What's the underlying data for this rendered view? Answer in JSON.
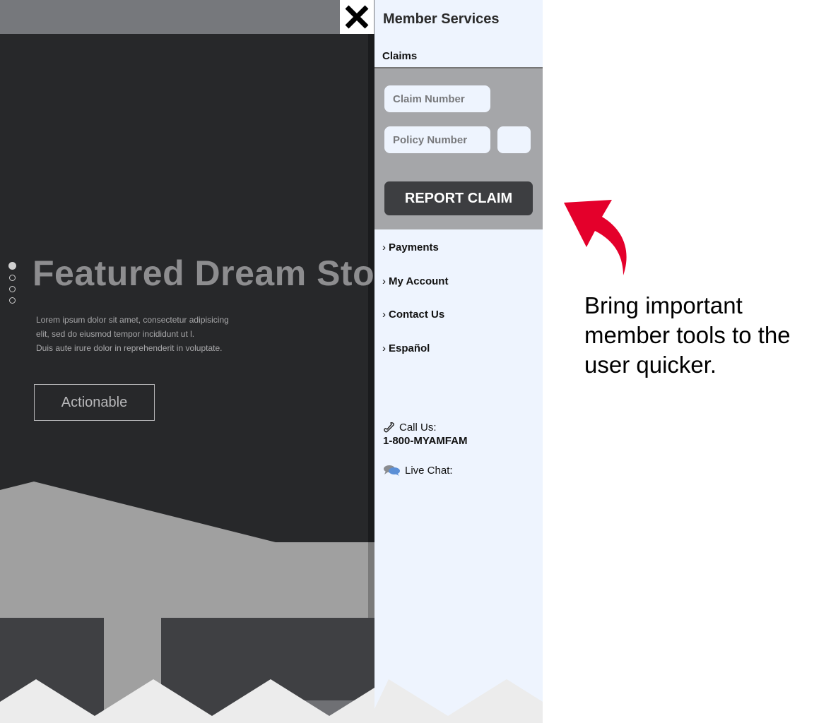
{
  "hero": {
    "title": "Featured Dream Story",
    "body_lines": [
      "Lorem ipsum dolor sit amet, consectetur adipisicing",
      "elit, sed do eiusmod tempor incididunt ut l.",
      "Duis aute irure dolor in reprehenderit in voluptate."
    ],
    "cta_label": "Actionable",
    "slide_count": 4,
    "active_slide": 1
  },
  "panel": {
    "title": "Member Services",
    "tab": "Claims",
    "claim_number_placeholder": "Claim Number",
    "policy_number_placeholder": "Policy Number",
    "report_button": "REPORT CLAIM",
    "nav": [
      {
        "chevron": "›",
        "label": "Payments"
      },
      {
        "chevron": "›",
        "label": "My Account"
      },
      {
        "chevron": "›",
        "label": "Contact Us"
      },
      {
        "chevron": "›",
        "label": "Español"
      }
    ],
    "call_label": "Call Us:",
    "phone": "1-800-MYAMFAM",
    "chat_label": "Live Chat:",
    "icons": {
      "close": "close-icon",
      "phone": "phone-icon",
      "chat": "chat-bubbles-icon"
    }
  },
  "annotation": {
    "text": "Bring important member tools to the user quicker.",
    "arrow_color": "#e4002b"
  },
  "colors": {
    "panel_bg": "#eef4fe",
    "hero_bg": "#27282a",
    "button_bg": "#3d3e41"
  }
}
